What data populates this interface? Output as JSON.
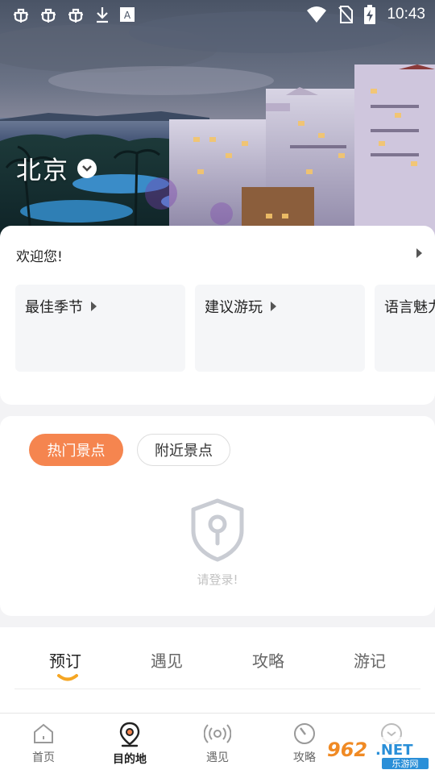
{
  "status_bar": {
    "time": "10:43",
    "left_icons": [
      "bug-icon",
      "bug-icon",
      "bug-icon",
      "download-icon",
      "font-a-icon"
    ],
    "right_icons": [
      "wifi-icon",
      "no-sim-icon",
      "battery-charging-icon"
    ]
  },
  "hero": {
    "city": "北京",
    "city_dropdown_icon": "chevron-down-icon"
  },
  "welcome": {
    "greeting": "欢迎您!",
    "features": [
      {
        "label": "最佳季节"
      },
      {
        "label": "建议游玩"
      },
      {
        "label": "语言魅力"
      }
    ]
  },
  "spots": {
    "tabs": [
      {
        "label": "热门景点",
        "active": true
      },
      {
        "label": "附近景点",
        "active": false
      }
    ],
    "empty_icon": "shield-lock-icon",
    "login_prompt": "请登录!"
  },
  "content_tabs": [
    {
      "label": "预订",
      "active": true
    },
    {
      "label": "遇见",
      "active": false
    },
    {
      "label": "攻略",
      "active": false
    },
    {
      "label": "游记",
      "active": false
    }
  ],
  "bottom_nav": [
    {
      "label": "首页",
      "icon": "home-icon",
      "active": false
    },
    {
      "label": "目的地",
      "icon": "location-pin-icon",
      "active": true
    },
    {
      "label": "遇见",
      "icon": "broadcast-icon",
      "active": false
    },
    {
      "label": "攻略",
      "icon": "compass-icon",
      "active": false
    },
    {
      "label": "",
      "icon": "profile-icon",
      "active": false
    }
  ],
  "watermark": {
    "text": "962.NET",
    "subtext": "乐游网"
  },
  "colors": {
    "accent": "#f5854f",
    "tab_underline": "#f5a623"
  }
}
